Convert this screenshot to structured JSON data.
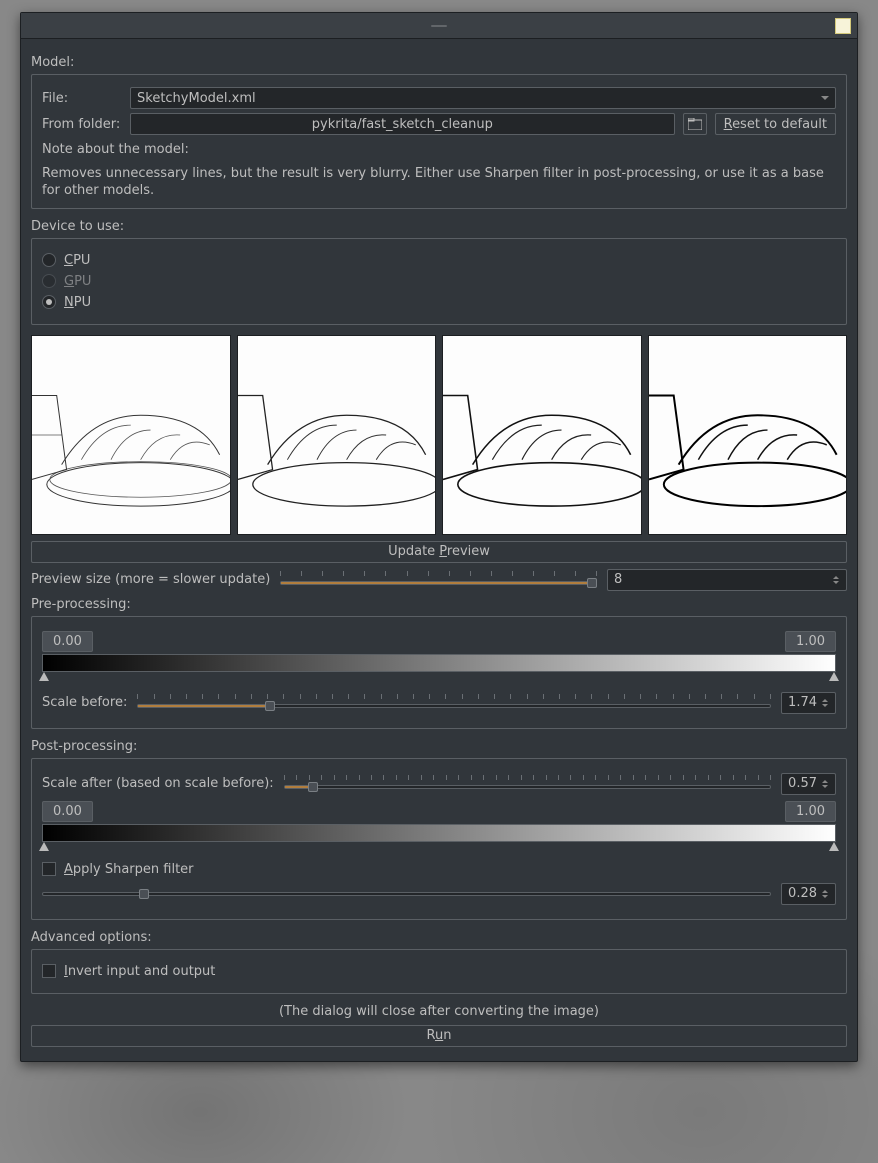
{
  "titlebar": {
    "title": " "
  },
  "model": {
    "section_label": "Model:",
    "file_label": "File:",
    "file_value": "SketchyModel.xml",
    "folder_label": "From folder:",
    "folder_value": "pykrita/fast_sketch_cleanup",
    "reset_label": "Reset to default",
    "note_label": "Note about the model:",
    "note_text": "Removes unnecessary lines, but the result is very blurry. Either use Sharpen filter in post-processing, or use it as a base for other models."
  },
  "device": {
    "section_label": "Device to use:",
    "cpu": "CPU",
    "gpu": "GPU",
    "npu": "NPU"
  },
  "preview": {
    "update_label": "Update Preview",
    "size_label": "Preview size (more = slower update)",
    "size_value": "8"
  },
  "pre": {
    "section_label": "Pre-processing:",
    "level_min": "0.00",
    "level_max": "1.00",
    "scale_before_label": "Scale before:",
    "scale_before_value": "1.74"
  },
  "post": {
    "section_label": "Post-processing:",
    "scale_after_label": "Scale after (based on scale before):",
    "scale_after_value": "0.57",
    "level_min": "0.00",
    "level_max": "1.00",
    "sharpen_label": "Apply Sharpen filter",
    "sharpen_value": "0.28"
  },
  "advanced": {
    "section_label": "Advanced options:",
    "invert_label": "Invert input and output"
  },
  "footer": {
    "info": "(The dialog will close after converting the image)",
    "run_label": "Run"
  }
}
